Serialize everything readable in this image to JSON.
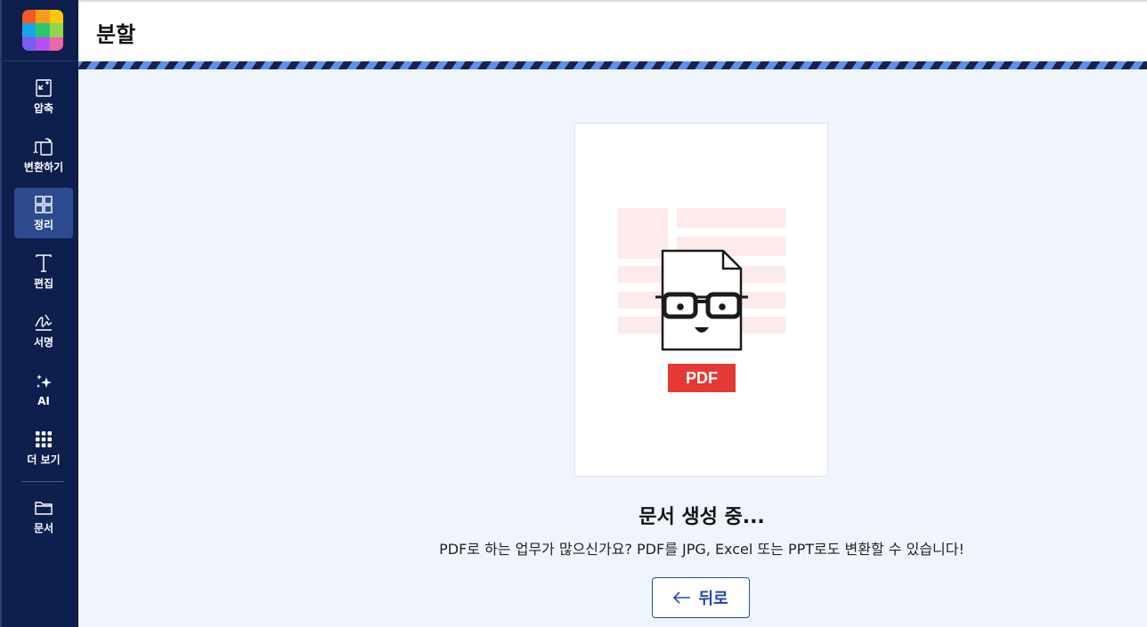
{
  "sidebar": {
    "items": [
      {
        "label": "압축",
        "icon": "compress-icon"
      },
      {
        "label": "변환하기",
        "icon": "convert-icon"
      },
      {
        "label": "정리",
        "icon": "organize-icon",
        "active": true
      },
      {
        "label": "편집",
        "icon": "edit-text-icon"
      },
      {
        "label": "서명",
        "icon": "signature-icon"
      },
      {
        "label": "AI",
        "icon": "ai-sparkle-icon"
      },
      {
        "label": "더 보기",
        "icon": "more-grid-icon"
      },
      {
        "label": "문서",
        "icon": "folder-icon"
      }
    ],
    "logo_colors": [
      "#f35a24",
      "#f99d1b",
      "#fdc80b",
      "#1ba4e8",
      "#28c76f",
      "#8ed84a",
      "#7b5cf0",
      "#b84ff0",
      "#f064a8"
    ]
  },
  "header": {
    "title": "분할"
  },
  "preview": {
    "badge": "PDF",
    "accent": "#e53935"
  },
  "status": {
    "title": "문서 생성 중...",
    "message": "PDF로 하는 업무가 많으신가요? PDF를 JPG, Excel 또는 PPT로도 변환할 수 있습니다!"
  },
  "back_button": {
    "label": "뒤로"
  },
  "colors": {
    "sidebar": "#0e1e4d",
    "sidebar_active": "#2d4a8e",
    "background": "#f0f5fd",
    "primary": "#1f4aa6"
  }
}
